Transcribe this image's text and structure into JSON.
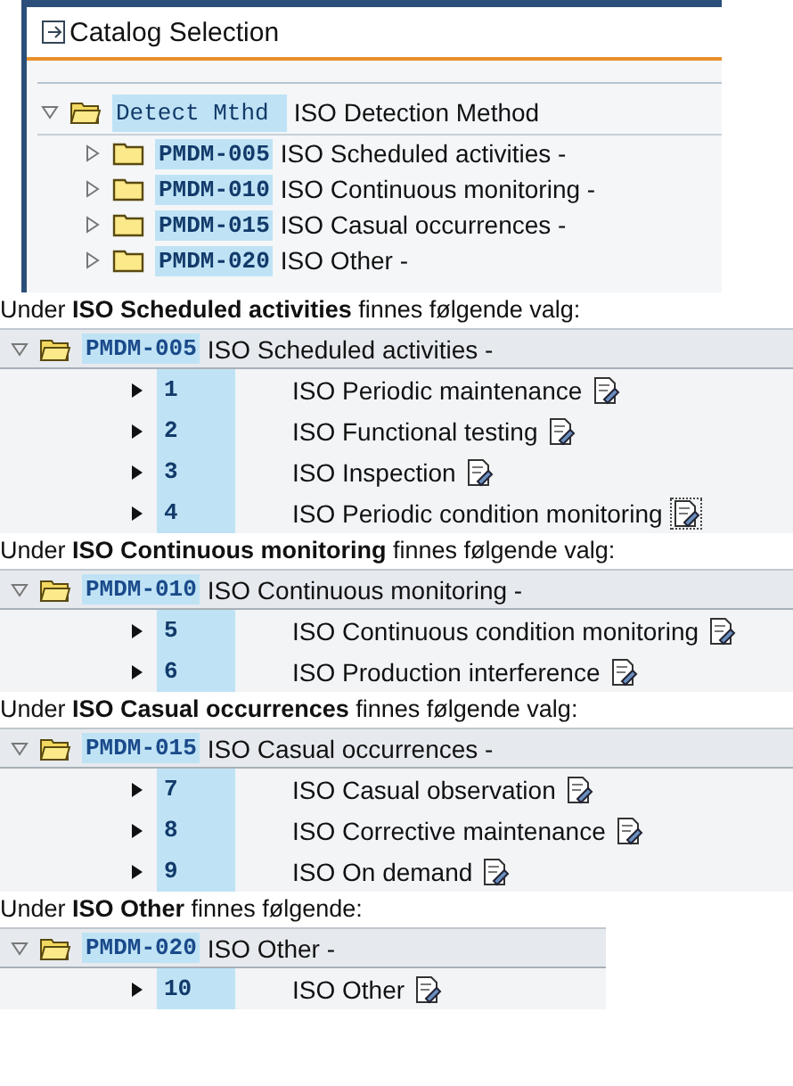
{
  "catalog_window": {
    "title": "Catalog Selection",
    "root": {
      "code": "Detect Mthd",
      "text": "ISO Detection Method",
      "expanded": true,
      "children": [
        {
          "code": "PMDM-005",
          "text": "ISO Scheduled activities -",
          "expanded": false
        },
        {
          "code": "PMDM-010",
          "text": "ISO Continuous monitoring -",
          "expanded": false
        },
        {
          "code": "PMDM-015",
          "text": "ISO Casual occurrences -",
          "expanded": false
        },
        {
          "code": "PMDM-020",
          "text": "ISO Other -",
          "expanded": false
        }
      ]
    }
  },
  "sections": [
    {
      "caption": "Under **ISO Scheduled activities** finnes følgende valg:",
      "group": {
        "code": "PMDM-005",
        "text": "ISO Scheduled activities -",
        "expanded": true
      },
      "items": [
        {
          "code": "1",
          "text": "ISO Periodic maintenance",
          "focused": false
        },
        {
          "code": "2",
          "text": "ISO Functional testing",
          "focused": false
        },
        {
          "code": "3",
          "text": "ISO Inspection",
          "focused": false
        },
        {
          "code": "4",
          "text": "ISO Periodic condition monitoring",
          "focused": true
        }
      ]
    },
    {
      "caption": "Under **ISO Continuous monitoring** finnes følgende valg:",
      "group": {
        "code": "PMDM-010",
        "text": "ISO Continuous monitoring -",
        "expanded": true
      },
      "items": [
        {
          "code": "5",
          "text": "ISO Continuous condition monitoring",
          "focused": false
        },
        {
          "code": "6",
          "text": "ISO Production interference",
          "focused": false
        }
      ]
    },
    {
      "caption": "Under **ISO Casual occurrences** finnes følgende valg:",
      "group": {
        "code": "PMDM-015",
        "text": "ISO Casual occurrences -",
        "expanded": true
      },
      "items": [
        {
          "code": "7",
          "text": "ISO Casual observation",
          "focused": false
        },
        {
          "code": "8",
          "text": "ISO Corrective maintenance",
          "focused": false
        },
        {
          "code": "9",
          "text": "ISO On demand",
          "focused": false
        }
      ]
    },
    {
      "caption": "Under **ISO Other** finnes følgende:",
      "group": {
        "code": "PMDM-020",
        "text": "ISO Other -",
        "expanded": true
      },
      "items": [
        {
          "code": "10",
          "text": "ISO Other",
          "focused": false
        }
      ]
    }
  ]
}
